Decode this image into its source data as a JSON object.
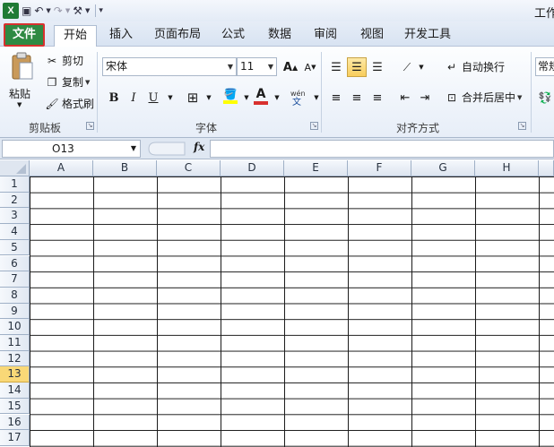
{
  "title_bar": {
    "title": "工作"
  },
  "tabs": {
    "file": "文件",
    "home": "开始",
    "insert": "插入",
    "page_layout": "页面布局",
    "formulas": "公式",
    "data": "数据",
    "review": "审阅",
    "view": "视图",
    "developer": "开发工具"
  },
  "clipboard": {
    "paste": "粘贴",
    "cut": "剪切",
    "copy": "复制",
    "format_painter": "格式刷",
    "group": "剪贴板"
  },
  "font": {
    "name": "宋体",
    "size": "11",
    "group": "字体"
  },
  "alignment": {
    "wrap_text": "自动换行",
    "merge_center": "合并后居中",
    "group": "对齐方式"
  },
  "number": {
    "format": "常规"
  },
  "formula_bar": {
    "name_box": "O13",
    "fx": "fx",
    "formula": ""
  },
  "columns": [
    "A",
    "B",
    "C",
    "D",
    "E",
    "F",
    "G",
    "H"
  ],
  "rows": [
    "1",
    "2",
    "3",
    "4",
    "5",
    "6",
    "7",
    "8",
    "9",
    "10",
    "11",
    "12",
    "13",
    "14",
    "15",
    "16",
    "17"
  ],
  "active_row": "13",
  "colors": {
    "file_tab": "#2f8a43",
    "file_tab_border": "#d8312e",
    "highlight": "#f8cd5c",
    "font_color": "#d8312e"
  }
}
